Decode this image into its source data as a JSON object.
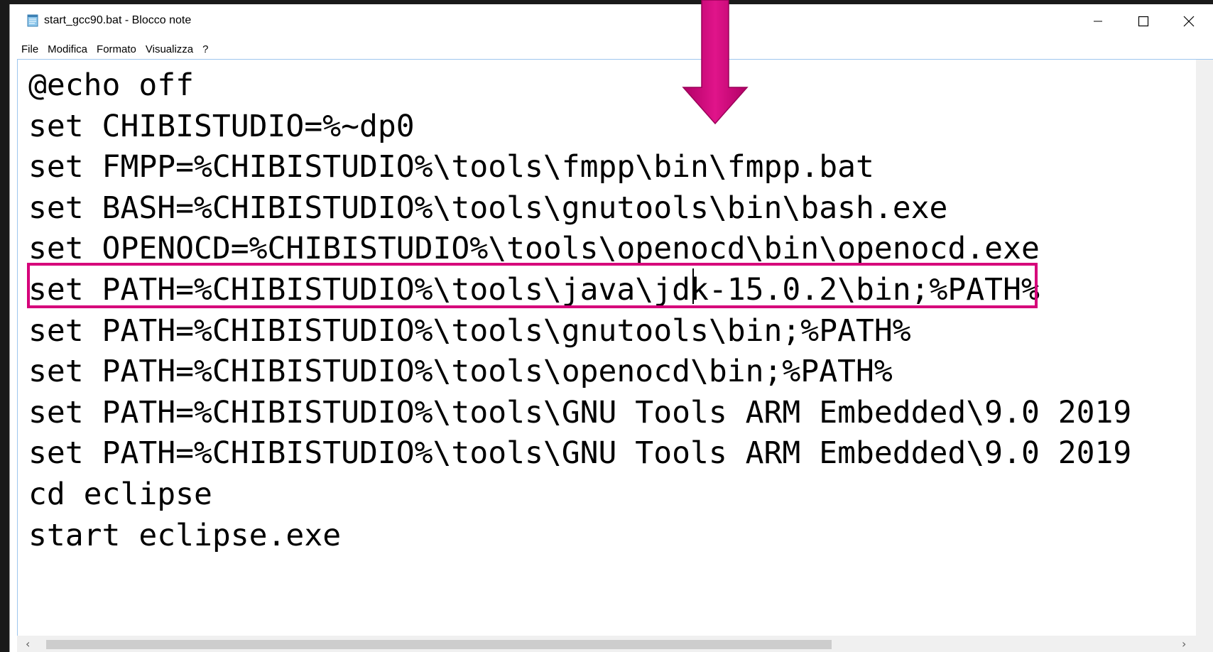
{
  "window": {
    "title": "start_gcc90.bat - Blocco note",
    "icon": "notepad-icon"
  },
  "window_controls": {
    "minimize_icon": "minimize-icon",
    "maximize_icon": "maximize-icon",
    "close_icon": "close-icon"
  },
  "menu": {
    "items": [
      {
        "label": "File"
      },
      {
        "label": "Modifica"
      },
      {
        "label": "Formato"
      },
      {
        "label": "Visualizza"
      },
      {
        "label": "?"
      }
    ]
  },
  "editor": {
    "lines": [
      "@echo off",
      "set CHIBISTUDIO=%~dp0",
      "set FMPP=%CHIBISTUDIO%\\tools\\fmpp\\bin\\fmpp.bat",
      "set BASH=%CHIBISTUDIO%\\tools\\gnutools\\bin\\bash.exe",
      "set OPENOCD=%CHIBISTUDIO%\\tools\\openocd\\bin\\openocd.exe",
      "set PATH=%CHIBISTUDIO%\\tools\\java\\jdk-15.0.2\\bin;%PATH%",
      "set PATH=%CHIBISTUDIO%\\tools\\gnutools\\bin;%PATH%",
      "set PATH=%CHIBISTUDIO%\\tools\\openocd\\bin;%PATH%",
      "set PATH=%CHIBISTUDIO%\\tools\\GNU Tools ARM Embedded\\9.0 2019",
      "set PATH=%CHIBISTUDIO%\\tools\\GNU Tools ARM Embedded\\9.0 2019",
      "cd eclipse",
      "start eclipse.exe"
    ],
    "highlighted_line_index": 5
  },
  "annotation": {
    "color": "#d6007a",
    "arrow_icon": "down-arrow-icon"
  },
  "scrollbar": {
    "left_arrow": "‹",
    "right_arrow": "›"
  }
}
